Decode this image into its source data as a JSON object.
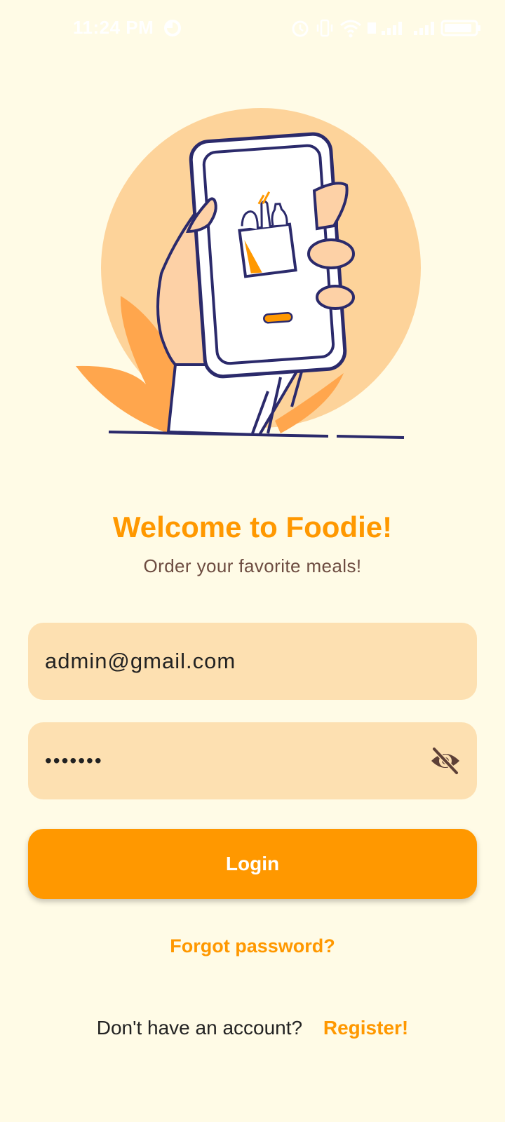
{
  "status_bar": {
    "time": "11:24 PM"
  },
  "header": {
    "title": "Welcome to Foodie!",
    "subtitle": "Order your favorite meals!"
  },
  "form": {
    "email_value": "admin@gmail.com",
    "password_masked": "•••••••",
    "password_visibility_icon": "eye-off-icon",
    "login_label": "Login",
    "forgot_label": "Forgot password?"
  },
  "footer": {
    "prompt": "Don't have an account?",
    "register_label": "Register!"
  },
  "colors": {
    "background": "#fffbe6",
    "accent": "#ff9800",
    "field_bg": "#fde0b1",
    "subtitle": "#6d4c41"
  }
}
